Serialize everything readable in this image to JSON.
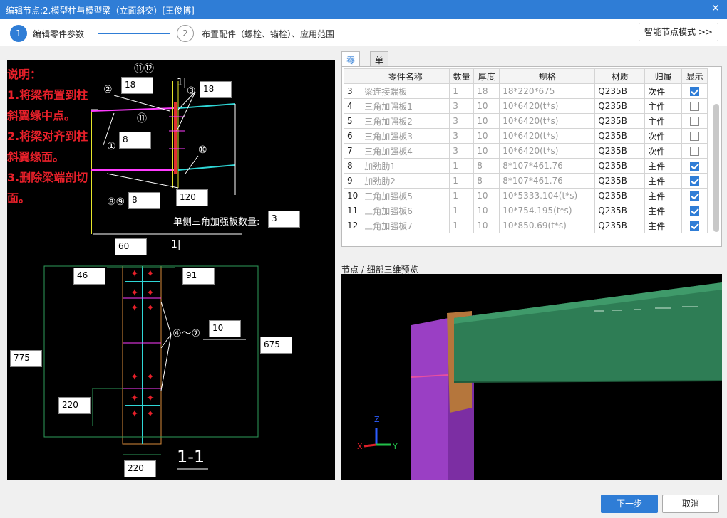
{
  "window": {
    "title": "编辑节点:2.模型柱与模型梁（立面斜交）[王俊博]"
  },
  "steps": [
    {
      "number": "1",
      "label": "编辑零件参数"
    },
    {
      "number": "2",
      "label": "布置配件（螺栓、锚栓）、应用范围"
    }
  ],
  "smart_mode_label": "智能节点模式 >>",
  "drawing": {
    "notes": [
      "说明：",
      "1.将梁布置到柱",
      "斜翼缘中点。",
      "2.将梁对齐到柱",
      "斜翼缘面。",
      "3.删除梁端剖切",
      "面。"
    ],
    "callouts": [
      "⑪⑫",
      "②",
      "③",
      "⑪",
      "①",
      "⑩",
      "⑧⑨",
      "④～⑦"
    ],
    "dims": {
      "d2": "18",
      "d3": "18",
      "d1": "8",
      "d89": "8",
      "d120": "120",
      "stiffener_count_label": "单侧三角加强板数量:",
      "stiffener_count": "3",
      "d60": "60",
      "d46": "46",
      "d91": "91",
      "d47": "10",
      "d775": "775",
      "d675": "675",
      "d220a": "220",
      "d220b": "220"
    },
    "section_title": "1-1",
    "section_marks": [
      "1|",
      "1|"
    ]
  },
  "tabs": [
    "零件",
    "单构件"
  ],
  "table": {
    "headers": [
      "",
      "零件名称",
      "数量",
      "厚度",
      "规格",
      "材质",
      "归属",
      "显示"
    ],
    "rows": [
      {
        "no": "3",
        "name": "梁连接端板",
        "qty": "1",
        "thk": "18",
        "spec": "18*220*675",
        "mat": "Q235B",
        "owner": "次件",
        "show": true
      },
      {
        "no": "4",
        "name": "三角加强板1",
        "qty": "3",
        "thk": "10",
        "spec": "10*6420(t*s)",
        "mat": "Q235B",
        "owner": "主件",
        "show": false
      },
      {
        "no": "5",
        "name": "三角加强板2",
        "qty": "3",
        "thk": "10",
        "spec": "10*6420(t*s)",
        "mat": "Q235B",
        "owner": "主件",
        "show": false
      },
      {
        "no": "6",
        "name": "三角加强板3",
        "qty": "3",
        "thk": "10",
        "spec": "10*6420(t*s)",
        "mat": "Q235B",
        "owner": "次件",
        "show": false
      },
      {
        "no": "7",
        "name": "三角加强板4",
        "qty": "3",
        "thk": "10",
        "spec": "10*6420(t*s)",
        "mat": "Q235B",
        "owner": "次件",
        "show": false
      },
      {
        "no": "8",
        "name": "加劲肋1",
        "qty": "1",
        "thk": "8",
        "spec": "8*107*461.76",
        "mat": "Q235B",
        "owner": "主件",
        "show": true
      },
      {
        "no": "9",
        "name": "加劲肋2",
        "qty": "1",
        "thk": "8",
        "spec": "8*107*461.76",
        "mat": "Q235B",
        "owner": "主件",
        "show": true
      },
      {
        "no": "10",
        "name": "三角加强板5",
        "qty": "1",
        "thk": "10",
        "spec": "10*5333.104(t*s)",
        "mat": "Q235B",
        "owner": "主件",
        "show": true
      },
      {
        "no": "11",
        "name": "三角加强板6",
        "qty": "1",
        "thk": "10",
        "spec": "10*754.195(t*s)",
        "mat": "Q235B",
        "owner": "主件",
        "show": true
      },
      {
        "no": "12",
        "name": "三角加强板7",
        "qty": "1",
        "thk": "10",
        "spec": "10*850.69(t*s)",
        "mat": "Q235B",
        "owner": "主件",
        "show": true
      }
    ]
  },
  "preview": {
    "label": "节点 / 细部三维预览",
    "axis_x": "X",
    "axis_y": "Y",
    "axis_z": "Z"
  },
  "buttons": {
    "next": "下一步",
    "cancel": "取消"
  },
  "colors": {
    "accent": "#2f7dd6",
    "note_red": "#e8202a",
    "beam_green": "#2e7d55",
    "column_purple": "#9a3fc4"
  }
}
